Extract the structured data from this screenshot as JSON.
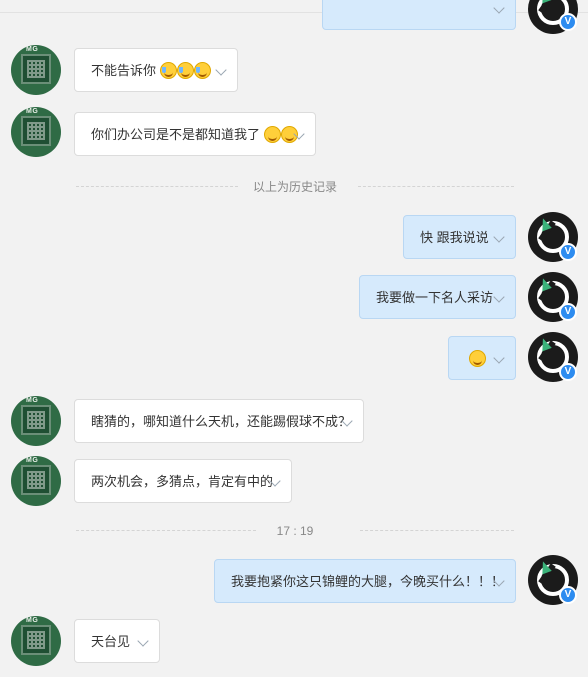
{
  "messages": [
    {
      "side": "out",
      "text": "",
      "partial": true
    },
    {
      "side": "in",
      "text": "不能告诉你"
    },
    {
      "side": "in",
      "text": "你们办公司是不是都知道我了"
    },
    {
      "side": "out",
      "text": "快 跟我说说"
    },
    {
      "side": "out",
      "text": "我要做一下名人采访"
    },
    {
      "side": "out",
      "text": ""
    },
    {
      "side": "in",
      "text": "瞎猜的，哪知道什么天机，还能踢假球不成？"
    },
    {
      "side": "in",
      "text": "两次机会，多猜点，肯定有中的"
    },
    {
      "side": "out",
      "text": "我要抱紧你这只锦鲤的大腿，今晚买什么！！！"
    },
    {
      "side": "in",
      "text": "天台见"
    }
  ],
  "dividers": {
    "history": "以上为历史记录",
    "time": "17 : 19"
  },
  "avatars": {
    "contact_logo_text": "MG",
    "verified_badge": "V"
  },
  "icons": {
    "menu": "chevron-down-icon",
    "laugh": "tears-of-joy-emoji-icon",
    "shy": "shy-face-emoji-icon",
    "scream": "screaming-face-emoji-icon"
  }
}
